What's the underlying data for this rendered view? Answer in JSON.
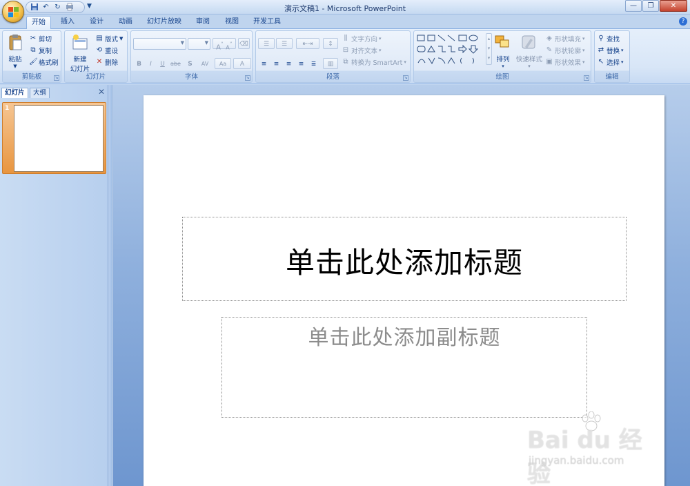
{
  "window": {
    "title": "演示文稿1 - Microsoft PowerPoint"
  },
  "qat": {
    "items": [
      "save-icon",
      "undo-icon",
      "redo-icon",
      "print-preview-icon"
    ]
  },
  "tabs": [
    "开始",
    "插入",
    "设计",
    "动画",
    "幻灯片放映",
    "审阅",
    "视图",
    "开发工具"
  ],
  "ribbon": {
    "clipboard": {
      "label": "剪贴板",
      "paste": "粘贴",
      "cut": "剪切",
      "copy": "复制",
      "format_painter": "格式刷"
    },
    "slides": {
      "label": "幻灯片",
      "new_slide_line1": "新建",
      "new_slide_line2": "幻灯片",
      "layout": "版式",
      "reset": "重设",
      "delete": "删除"
    },
    "font": {
      "label": "字体",
      "font_name": "",
      "font_size": "",
      "grow": "A",
      "shrink": "A",
      "bold": "B",
      "italic": "I",
      "underline": "U",
      "strike": "abe",
      "shadow": "S",
      "spacing": "AV",
      "case": "Aa",
      "color": "A"
    },
    "paragraph": {
      "label": "段落",
      "text_direction": "文字方向",
      "align_text": "对齐文本",
      "convert_smartart": "转换为 SmartArt"
    },
    "drawing": {
      "label": "绘图",
      "arrange": "排列",
      "quick_styles": "快速样式",
      "shape_fill": "形状填充",
      "shape_outline": "形状轮廓",
      "shape_effects": "形状效果"
    },
    "editing": {
      "label": "编辑",
      "find": "查找",
      "replace": "替换",
      "select": "选择"
    }
  },
  "left_pane": {
    "tab_slides": "幻灯片",
    "tab_outline": "大纲",
    "slide_number": "1"
  },
  "slide": {
    "title_placeholder": "单击此处添加标题",
    "subtitle_placeholder": "单击此处添加副标题"
  },
  "watermark": {
    "brand": "Bai du 经验",
    "url": "jingyan.baidu.com"
  },
  "colors": {
    "ribbon_bg": "#dbe7f7",
    "accent_orange": "#e8953f",
    "workspace_bg": "#8fb0dd"
  }
}
